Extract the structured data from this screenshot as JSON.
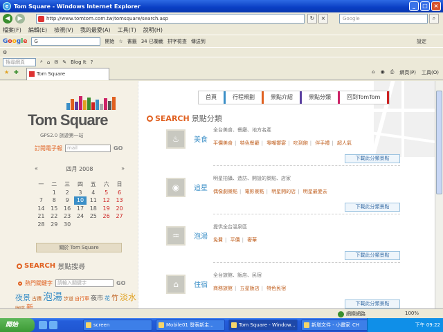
{
  "window": {
    "title": "Tom Square - Windows Internet Explorer"
  },
  "address": {
    "url": "http://www.tomtom.com.tw/tomsquare/search.asp",
    "search_placeholder": "Google"
  },
  "menu": [
    "檔案(F)",
    "編輯(E)",
    "檢視(V)",
    "我的最愛(A)",
    "工具(T)",
    "說明(H)"
  ],
  "google_toolbar": {
    "box": "G",
    "go": "開始",
    "bookmarks": "書籤",
    "blocked": "34 已攔截",
    "spell": "拼字檢查",
    "send": "傳送到",
    "settings": "設定"
  },
  "toolbar3": {
    "search_placeholder": "搜尋網頁",
    "blog": "Blog It"
  },
  "tab": {
    "label": "Tom Square"
  },
  "ie_tools": {
    "page": "網頁(P)",
    "tools": "工具(O)"
  },
  "logo": {
    "name": "Tom Square",
    "sub": "GPS2.0 旅遊第一站"
  },
  "subscribe": {
    "label": "訂閱電子報",
    "placeholder": "mail",
    "go": "GO"
  },
  "calendar": {
    "month": "四月 2008",
    "prev": "«",
    "next": "»",
    "weekdays": [
      "一",
      "二",
      "三",
      "四",
      "五",
      "六",
      "日"
    ],
    "rows": [
      [
        "",
        "1",
        "2",
        "3",
        "4",
        "5",
        "6"
      ],
      [
        "7",
        "8",
        "9",
        "10",
        "11",
        "12",
        "13"
      ],
      [
        "14",
        "15",
        "16",
        "17",
        "18",
        "19",
        "20"
      ],
      [
        "21",
        "22",
        "23",
        "24",
        "25",
        "26",
        "27"
      ],
      [
        "28",
        "29",
        "30",
        "",
        "",
        "",
        ""
      ]
    ]
  },
  "about": "關於 Tom Square",
  "left_search": {
    "en": "SEARCH",
    "zh": "景點搜尋"
  },
  "keyword": {
    "label": "熱門關鍵字",
    "placeholder": "請輸入關鍵字",
    "go": "GO"
  },
  "tag_cloud": [
    {
      "t": "夜景",
      "c": "#3b8fc7",
      "s": 11
    },
    {
      "t": "古蹟",
      "c": "#c06020",
      "s": 7
    },
    {
      "t": "泡湯",
      "c": "#3b8fc7",
      "s": 14
    },
    {
      "t": "步道",
      "c": "#c06020",
      "s": 7
    },
    {
      "t": "自行車",
      "c": "#e06020",
      "s": 7
    },
    {
      "t": "夜市",
      "c": "#555",
      "s": 9
    },
    {
      "t": "花",
      "c": "#3b8fc7",
      "s": 8
    },
    {
      "t": "竹",
      "c": "#c06020",
      "s": 10
    },
    {
      "t": "淡水",
      "c": "#e0a020",
      "s": 12
    },
    {
      "t": "咖啡",
      "c": "#c06020",
      "s": 7
    },
    {
      "t": "新",
      "c": "#e06020",
      "s": 10
    }
  ],
  "topnav": [
    {
      "label": "首頁",
      "color": "#3b8fc7"
    },
    {
      "label": "行程規劃",
      "color": "#e06020"
    },
    {
      "label": "景點介紹",
      "color": "#5a3fa0"
    },
    {
      "label": "景點分類",
      "color": "#cc2266"
    },
    {
      "label": "回到TomTom",
      "color": "#cc2222"
    }
  ],
  "main_title": {
    "en": "SEARCH",
    "zh": "景點分類"
  },
  "categories": [
    {
      "name": "美食",
      "icon": "food-icon",
      "glyph": "♨",
      "desc": "全台美食、餐廳、地方名產",
      "links": [
        "平價美食",
        "特色餐廳",
        "零嘴饗宴",
        "吃到飽",
        "伴手禮",
        "超人氣"
      ],
      "dl": "下載此分類景點"
    },
    {
      "name": "追星",
      "icon": "camera-icon",
      "glyph": "◉",
      "desc": "明星拍攝、造訪、開設的景點、店家",
      "links": [
        "偶像劇景點",
        "電影景點",
        "明星開的店",
        "明星最愛去"
      ],
      "dl": "下載此分類景點"
    },
    {
      "name": "泡湯",
      "icon": "hotspring-icon",
      "glyph": "♒",
      "desc": "提供全台溫泉區",
      "links": [
        "免費",
        "平價",
        "奢華"
      ],
      "dl": "下載此分類景點"
    },
    {
      "name": "住宿",
      "icon": "lodging-icon",
      "glyph": "⌂",
      "desc": "全台旅館、飯店、民宿",
      "links": [
        "商務旅館",
        "五星飯店",
        "特色民宿"
      ],
      "dl": "下載此分類景點"
    }
  ],
  "status": {
    "zone": "網際網路",
    "zoom": "100%"
  },
  "taskbar": {
    "start": "開始",
    "buttons": [
      {
        "label": "screen",
        "active": false
      },
      {
        "label": "Mobile01 發表新主...",
        "active": false
      },
      {
        "label": "Tom Square - Window...",
        "active": true
      },
      {
        "label": "新增文件 - 小畫家",
        "active": false
      }
    ],
    "lang": "CH",
    "time": "下午 09:22"
  }
}
